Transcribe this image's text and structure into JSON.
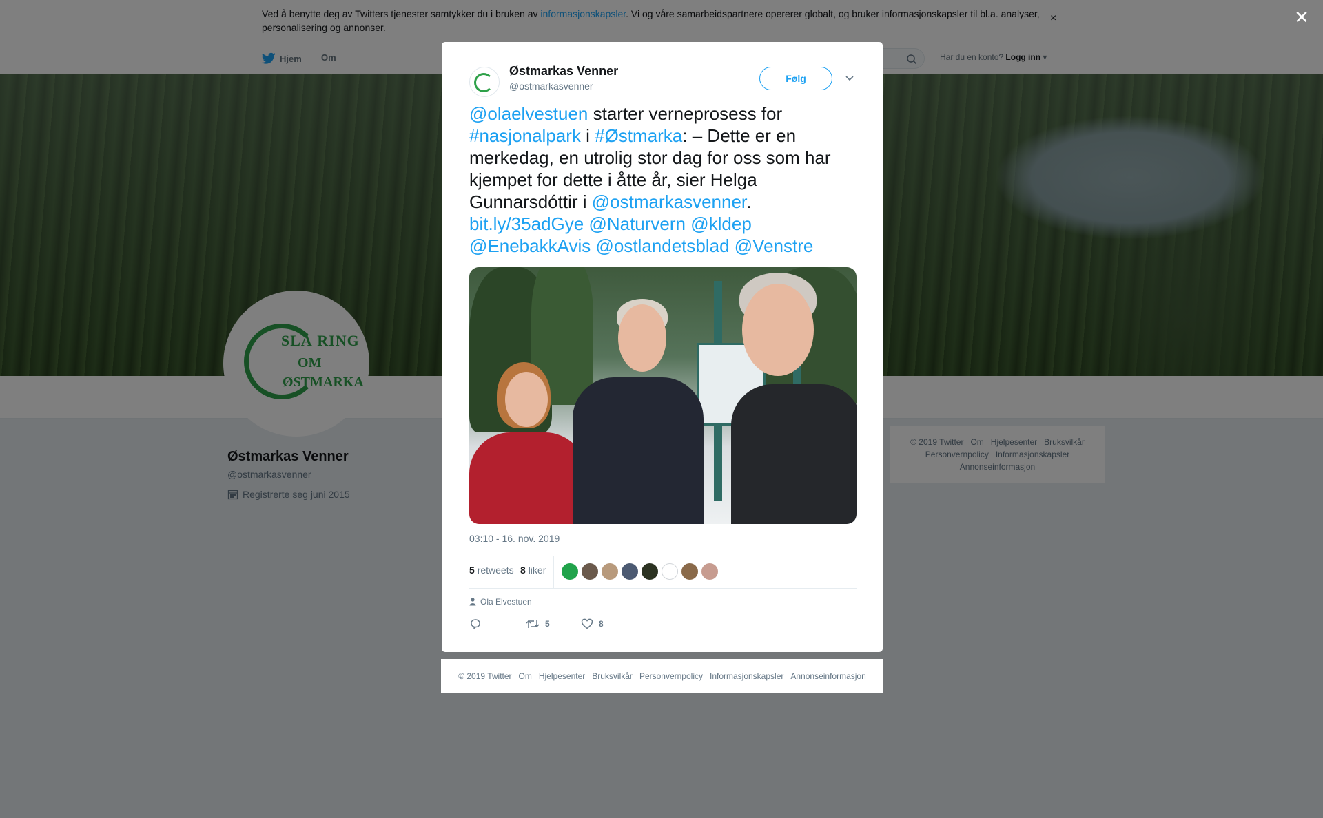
{
  "cookie": {
    "text_before": "Ved å benytte deg av Twitters tjenester samtykker du i bruken av ",
    "link": "informasjonskapsler",
    "text_after": ". Vi og våre samarbeidspartnere opererer globalt, og bruker informasjonskapsler til bl.a. analyser, personalisering og annonser.",
    "close": "×"
  },
  "nav": {
    "home": "Hjem",
    "about": "Om",
    "account_prompt": "Har du en konto?",
    "login": "Logg inn"
  },
  "profile": {
    "name": "Østmarkas Venner",
    "handle": "@ostmarkasvenner",
    "joined": "Registrerte seg juni 2015",
    "avatar_text": [
      "SLÅ RING",
      "OM",
      "ØSTMARKA"
    ]
  },
  "side_footer": {
    "items": [
      "© 2019 Twitter",
      "Om",
      "Hjelpesenter",
      "Bruksvilkår",
      "Personvernpolicy",
      "Informasjonskapsler",
      "Annonseinformasjon"
    ]
  },
  "overlay": {
    "close": "✕"
  },
  "tweet": {
    "author_name": "Østmarkas Venner",
    "author_handle": "@ostmarkasvenner",
    "follow": "Følg",
    "text": {
      "m1": "@olaelvestuen",
      "t1": " starter verneprosess for ",
      "h1": "#nasjonalpark",
      "t2": " i ",
      "h2": "#Østmarka",
      "t3": ": – Dette er en merkedag, en utrolig stor dag for oss som har kjempet for dette i åtte år, sier Helga Gunnarsdóttir i ",
      "m2": "@ostmarkasvenner",
      "t4": ". ",
      "url": "bit.ly/35adGye",
      "m3": "@Naturvern",
      "m4": "@kldep",
      "m5": "@EnebakkAvis",
      "m6": "@ostlandetsblad",
      "m7": "@Venstre"
    },
    "timestamp": "03:10 - 16. nov. 2019",
    "retweets_count": "5",
    "retweets_label": "retweets",
    "likes_count": "8",
    "likes_label": "liker",
    "mentioned_user": "Ola Elvestuen",
    "actions": {
      "retweet_count": "5",
      "like_count": "8"
    }
  },
  "modal_footer": {
    "items": [
      "© 2019 Twitter",
      "Om",
      "Hjelpesenter",
      "Bruksvilkår",
      "Personvernpolicy",
      "Informasjonskapsler",
      "Annonseinformasjon"
    ]
  },
  "colors": {
    "accent": "#1da1f2",
    "brand_green": "#2fa14a",
    "muted": "#657786"
  }
}
